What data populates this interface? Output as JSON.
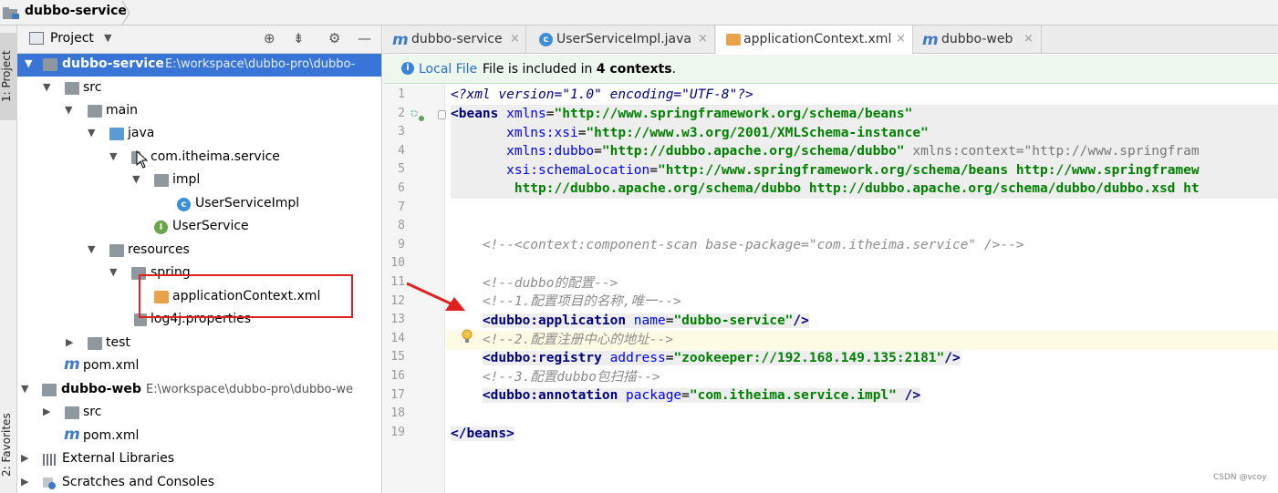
{
  "breadcrumb": {
    "project": "dubbo-service"
  },
  "left_strip": {
    "project_tab": "1: Project",
    "favorites_tab": "2: Favorites"
  },
  "project_panel": {
    "title": "Project",
    "tree": [
      {
        "label": "dubbo-service",
        "path": "E:\\workspace\\dubbo-pro\\dubbo-",
        "bold": true
      },
      {
        "label": "src"
      },
      {
        "label": "main"
      },
      {
        "label": "java"
      },
      {
        "label": "com.itheima.service"
      },
      {
        "label": "impl"
      },
      {
        "label": "UserServiceImpl"
      },
      {
        "label": "UserService"
      },
      {
        "label": "resources"
      },
      {
        "label": "spring"
      },
      {
        "label": "applicationContext.xml"
      },
      {
        "label": "log4j.properties"
      },
      {
        "label": "test"
      },
      {
        "label": "pom.xml"
      },
      {
        "label": "dubbo-web",
        "path": "E:\\workspace\\dubbo-pro\\dubbo-we",
        "bold": true
      },
      {
        "label": "src"
      },
      {
        "label": "pom.xml"
      },
      {
        "label": "External Libraries"
      },
      {
        "label": "Scratches and Consoles"
      }
    ]
  },
  "editor": {
    "tabs": [
      {
        "label": "dubbo-service",
        "icon": "maven-icon"
      },
      {
        "label": "UserServiceImpl.java",
        "icon": "class-icon"
      },
      {
        "label": "applicationContext.xml",
        "icon": "xml-icon",
        "active": true
      },
      {
        "label": "dubbo-web",
        "icon": "maven-icon"
      }
    ],
    "notice": {
      "link": "Local File",
      "text_prefix": "File is included in",
      "count": "4 contexts",
      "suffix": "."
    },
    "line_numbers": [
      "1",
      "2",
      "3",
      "4",
      "5",
      "6",
      "7",
      "8",
      "9",
      "10",
      "11",
      "12",
      "13",
      "14",
      "15",
      "16",
      "17",
      "18",
      "19"
    ],
    "lines": {
      "l1": "<?xml version=\"1.0\" encoding=\"UTF-8\"?>",
      "l2a": "<beans",
      "l2b": " xmlns",
      "l2c": "=",
      "l2d": "\"http://www.springframework.org/schema/beans\"",
      "l3a": "       xmlns:xsi",
      "l3b": "=",
      "l3c": "\"http://www.w3.org/2001/XMLSchema-instance\"",
      "l4a": "       xmlns:dubbo",
      "l4b": "=",
      "l4c": "\"http://dubbo.apache.org/schema/dubbo\"",
      "l4d": " xmlns:context=\"http://www.springfram",
      "l5a": "       xsi:schemaLocation",
      "l5b": "=",
      "l5c": "\"http://www.springframework.org/schema/beans http://www.springframew",
      "l6": "        http://dubbo.apache.org/schema/dubbo http://dubbo.apache.org/schema/dubbo/dubbo.xsd ht",
      "l9": "    <!--<context:component-scan base-package=\"com.itheima.service\" />-->",
      "l11": "    <!--dubbo的配置-->",
      "l12": "    <!--1.配置项目的名称,唯一-->",
      "l13a": "<dubbo:application",
      "l13b": " name",
      "l13c": "=",
      "l13d": "\"dubbo-service\"",
      "l13e": "/>",
      "l14": "    <!--2.配置注册中心的地址-->",
      "l15a": "<dubbo:registry",
      "l15b": " address",
      "l15c": "=",
      "l15d": "\"zookeeper://192.168.149.135:2181\"",
      "l15e": "/>",
      "l16": "    <!--3.配置dubbo包扫描-->",
      "l17a": "<dubbo:annotation",
      "l17b": " package",
      "l17c": "=",
      "l17d": "\"com.itheima.service.impl\"",
      "l17e": " />",
      "l19": "</beans>"
    }
  },
  "watermark": "CSDN @vcoy",
  "colors": {
    "selection": "#3875d6",
    "annotation_red": "#e02020",
    "tag": "#000080",
    "string": "#008000",
    "comment": "#8c8c8c"
  }
}
